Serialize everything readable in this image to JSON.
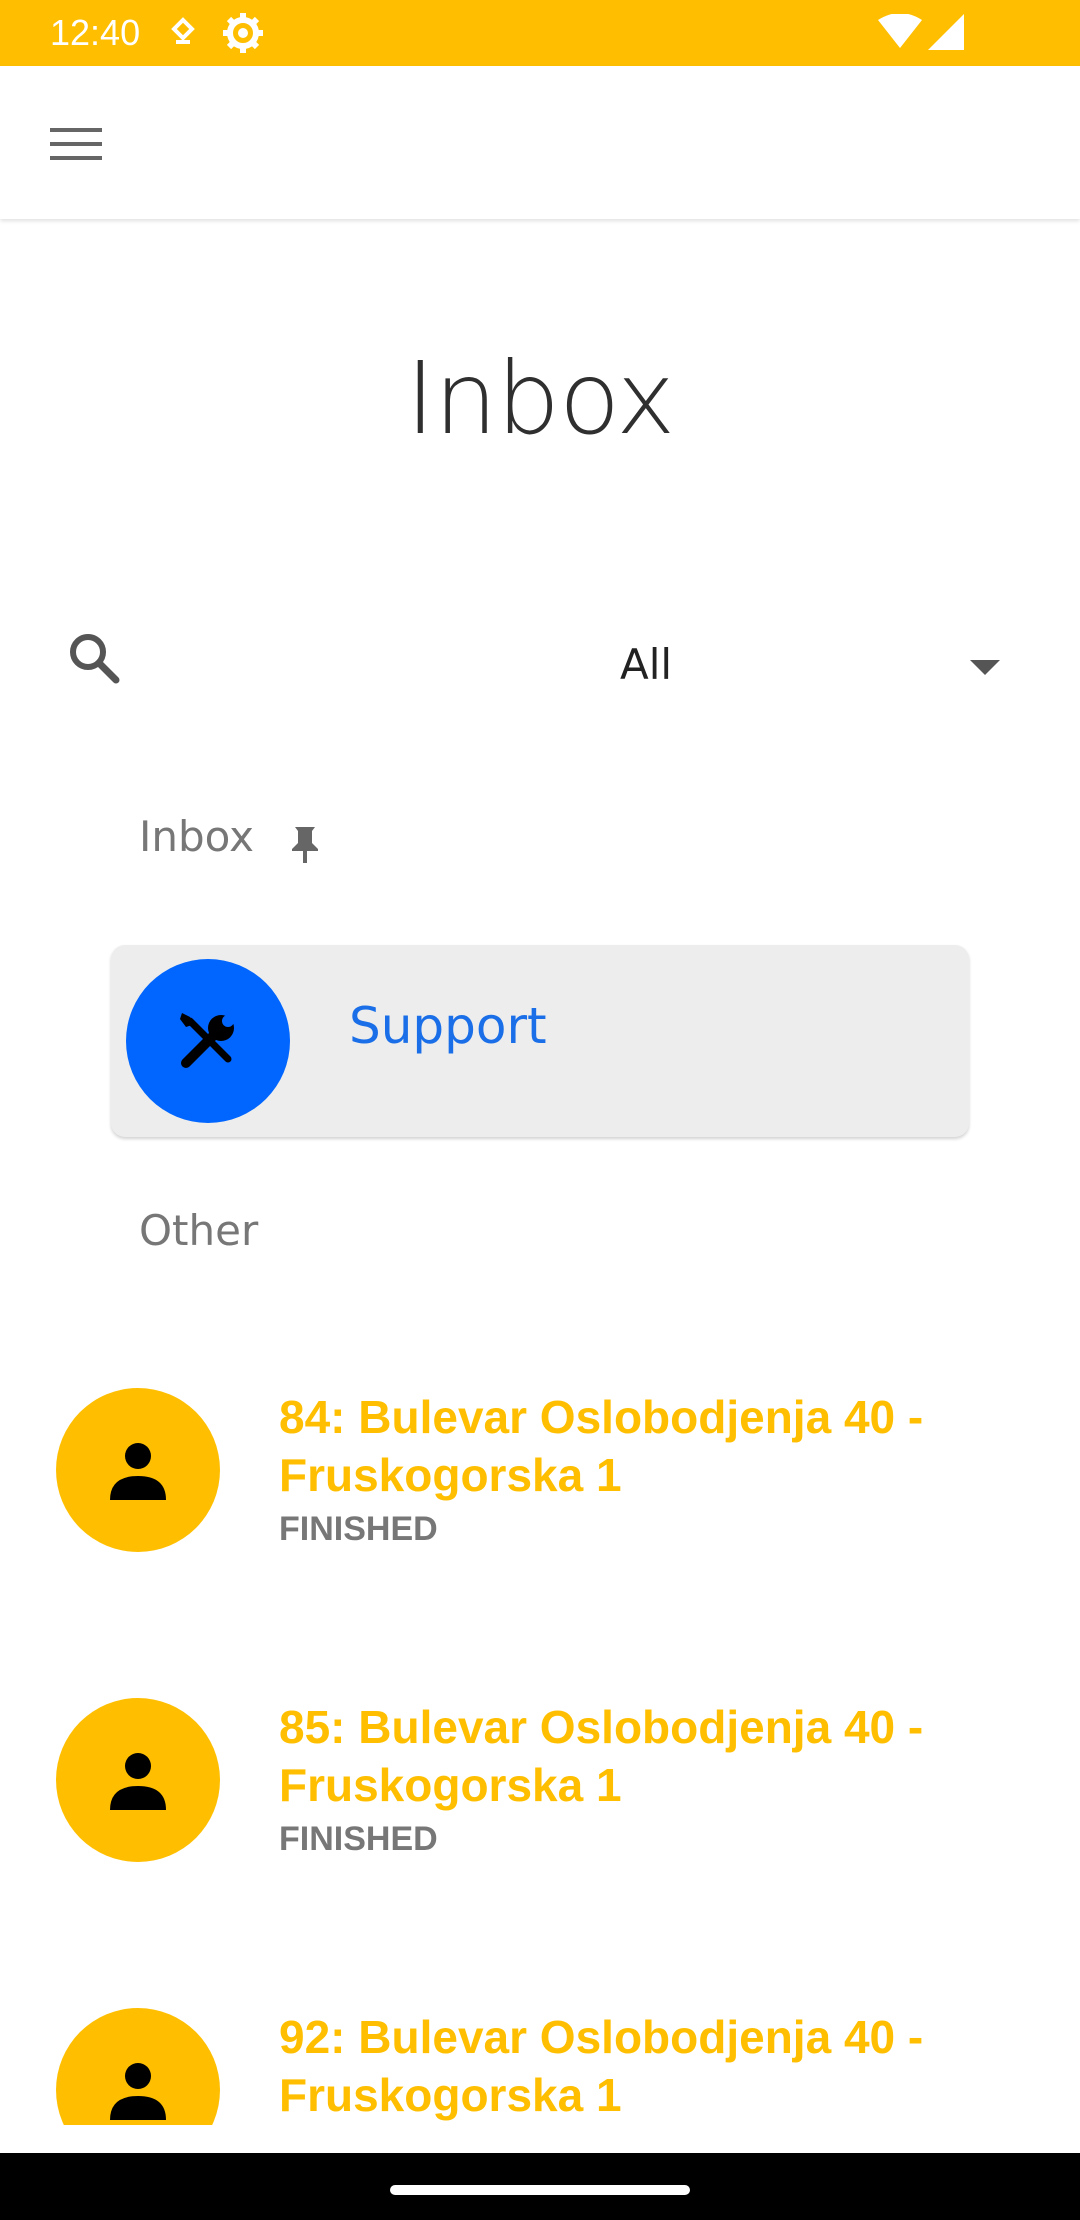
{
  "status_bar": {
    "time": "12:40",
    "icons": [
      "notification-icon",
      "settings-gear-icon",
      "wifi-icon",
      "signal-icon"
    ],
    "color": "#FFBF00"
  },
  "app_bar": {
    "menu_icon": "hamburger-menu-icon"
  },
  "page": {
    "title": "Inbox"
  },
  "filter": {
    "search_icon": "search-icon",
    "selected": "All"
  },
  "sections": {
    "pinned_label": "Inbox",
    "other_label": "Other"
  },
  "pinned": [
    {
      "name": "Support",
      "icon": "tools-icon",
      "avatar_color": "#0066FF"
    }
  ],
  "conversations": [
    {
      "title": "84: Bulevar Oslobodjenja 40 - Fruskogorska 1",
      "status": "FINISHED",
      "icon": "person-icon"
    },
    {
      "title": "85: Bulevar Oslobodjenja 40 - Fruskogorska 1",
      "status": "FINISHED",
      "icon": "person-icon"
    },
    {
      "title": "92: Bulevar Oslobodjenja 40 - Fruskogorska 1",
      "status": "",
      "icon": "person-icon"
    }
  ],
  "colors": {
    "accent": "#FFBF00",
    "support_blue": "#0066FF",
    "status_gray": "#777777"
  }
}
